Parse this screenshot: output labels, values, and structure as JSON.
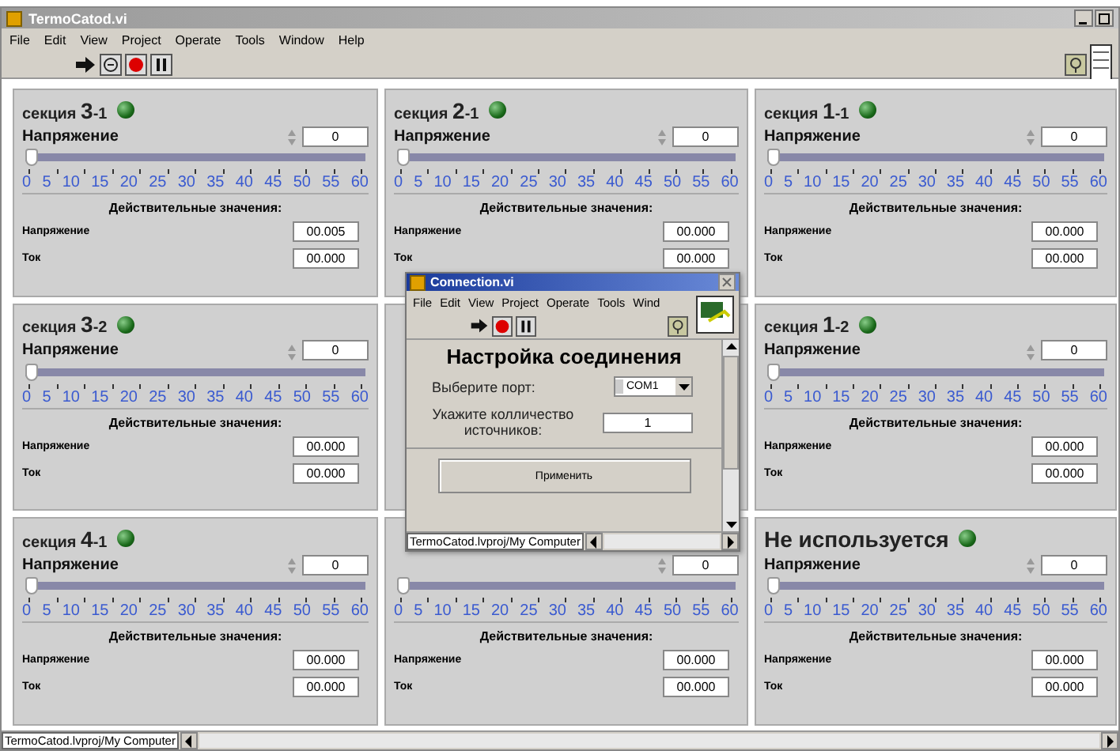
{
  "window": {
    "title": "TermoCatod.vi"
  },
  "menu": [
    "File",
    "Edit",
    "View",
    "Project",
    "Operate",
    "Tools",
    "Window",
    "Help"
  ],
  "panels": [
    {
      "kind": "section",
      "title": "секция **3**-1",
      "led_on": true,
      "label": "Напряжение",
      "value": "0",
      "level": 0,
      "scale": [
        "0",
        "5",
        "10",
        "15",
        "20",
        "25",
        "30",
        "35",
        "40",
        "45",
        "50",
        "55",
        "60"
      ],
      "readings_title": "Действительные значения:",
      "readings": [
        {
          "name": "Напряжение",
          "value": "00.005"
        },
        {
          "name": "Ток",
          "value": "00.000"
        }
      ]
    },
    {
      "kind": "section",
      "title": "секция **2**-1",
      "led_on": true,
      "label": "Напряжение",
      "value": "0",
      "level": 0,
      "scale": [
        "0",
        "5",
        "10",
        "15",
        "20",
        "25",
        "30",
        "35",
        "40",
        "45",
        "50",
        "55",
        "60"
      ],
      "readings_title": "Действительные значения:",
      "readings": [
        {
          "name": "Напряжение",
          "value": "00.000"
        },
        {
          "name": "Ток",
          "value": "00.000"
        }
      ]
    },
    {
      "kind": "section",
      "title": "секция **1**-1",
      "led_on": true,
      "label": "Напряжение",
      "value": "0",
      "level": 0,
      "scale": [
        "0",
        "5",
        "10",
        "15",
        "20",
        "25",
        "30",
        "35",
        "40",
        "45",
        "50",
        "55",
        "60"
      ],
      "readings_title": "Действительные значения:",
      "readings": [
        {
          "name": "Напряжение",
          "value": "00.000"
        },
        {
          "name": "Ток",
          "value": "00.000"
        }
      ]
    },
    {
      "kind": "section",
      "title": "секция **3**-2",
      "led_on": true,
      "label": "Напряжение",
      "value": "0",
      "level": 0,
      "scale": [
        "0",
        "5",
        "10",
        "15",
        "20",
        "25",
        "30",
        "35",
        "40",
        "45",
        "50",
        "55",
        "60"
      ],
      "readings_title": "Действительные значения:",
      "readings": [
        {
          "name": "Напряжение",
          "value": "00.000"
        },
        {
          "name": "Ток",
          "value": "00.000"
        }
      ]
    },
    {
      "kind": "covered"
    },
    {
      "kind": "section",
      "title": "секция **1**-2",
      "led_on": true,
      "label": "Напряжение",
      "value": "0",
      "level": 0,
      "scale": [
        "0",
        "5",
        "10",
        "15",
        "20",
        "25",
        "30",
        "35",
        "40",
        "45",
        "50",
        "55",
        "60"
      ],
      "readings_title": "Действительные значения:",
      "readings": [
        {
          "name": "Напряжение",
          "value": "00.000"
        },
        {
          "name": "Ток",
          "value": "00.000"
        }
      ]
    },
    {
      "kind": "section",
      "title": "секция **4**-1",
      "led_on": true,
      "label": "Напряжение",
      "value": "0",
      "level": 0,
      "scale": [
        "0",
        "5",
        "10",
        "15",
        "20",
        "25",
        "30",
        "35",
        "40",
        "45",
        "50",
        "55",
        "60"
      ],
      "readings_title": "Действительные значения:",
      "readings": [
        {
          "name": "Напряжение",
          "value": "00.000"
        },
        {
          "name": "Ток",
          "value": "00.000"
        }
      ]
    },
    {
      "kind": "section",
      "value": "0",
      "level": 0,
      "scale": [
        "0",
        "5",
        "10",
        "15",
        "20",
        "25",
        "30",
        "35",
        "40",
        "45",
        "50",
        "55",
        "60"
      ],
      "readings_title": "Действительные значения:",
      "readings": [
        {
          "name": "Напряжение",
          "value": "00.000"
        },
        {
          "name": "Ток",
          "value": "00.000"
        }
      ]
    },
    {
      "kind": "unused",
      "title": "Не используется",
      "led_on": true,
      "label": "Напряжение",
      "value": "0",
      "level": 0,
      "scale": [
        "0",
        "5",
        "10",
        "15",
        "20",
        "25",
        "30",
        "35",
        "40",
        "45",
        "50",
        "55",
        "60"
      ],
      "readings_title": "Действительные значения:",
      "readings": [
        {
          "name": "Напряжение",
          "value": "00.000"
        },
        {
          "name": "Ток",
          "value": "00.000"
        }
      ]
    }
  ],
  "status_bar": "TermoCatod.lvproj/My Computer",
  "dialog": {
    "title": "Connection.vi",
    "menu": [
      "File",
      "Edit",
      "View",
      "Project",
      "Operate",
      "Tools",
      "Wind"
    ],
    "heading": "Настройка соединения",
    "port_label": "Выберите порт:",
    "port": "COM1",
    "count_label": "Укажите колличество источников:",
    "count": "1",
    "button": "Применить",
    "status_bar": "TermoCatod.lvproj/My Computer"
  }
}
